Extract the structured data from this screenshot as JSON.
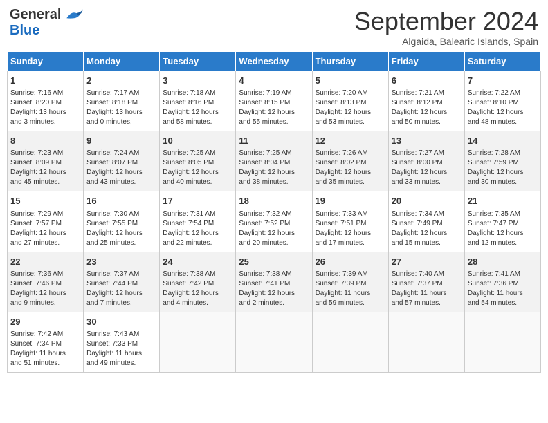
{
  "header": {
    "logo_general": "General",
    "logo_blue": "Blue",
    "month_title": "September 2024",
    "location": "Algaida, Balearic Islands, Spain"
  },
  "weekdays": [
    "Sunday",
    "Monday",
    "Tuesday",
    "Wednesday",
    "Thursday",
    "Friday",
    "Saturday"
  ],
  "weeks": [
    [
      {
        "day": "1",
        "info": "Sunrise: 7:16 AM\nSunset: 8:20 PM\nDaylight: 13 hours\nand 3 minutes."
      },
      {
        "day": "2",
        "info": "Sunrise: 7:17 AM\nSunset: 8:18 PM\nDaylight: 13 hours\nand 0 minutes."
      },
      {
        "day": "3",
        "info": "Sunrise: 7:18 AM\nSunset: 8:16 PM\nDaylight: 12 hours\nand 58 minutes."
      },
      {
        "day": "4",
        "info": "Sunrise: 7:19 AM\nSunset: 8:15 PM\nDaylight: 12 hours\nand 55 minutes."
      },
      {
        "day": "5",
        "info": "Sunrise: 7:20 AM\nSunset: 8:13 PM\nDaylight: 12 hours\nand 53 minutes."
      },
      {
        "day": "6",
        "info": "Sunrise: 7:21 AM\nSunset: 8:12 PM\nDaylight: 12 hours\nand 50 minutes."
      },
      {
        "day": "7",
        "info": "Sunrise: 7:22 AM\nSunset: 8:10 PM\nDaylight: 12 hours\nand 48 minutes."
      }
    ],
    [
      {
        "day": "8",
        "info": "Sunrise: 7:23 AM\nSunset: 8:09 PM\nDaylight: 12 hours\nand 45 minutes."
      },
      {
        "day": "9",
        "info": "Sunrise: 7:24 AM\nSunset: 8:07 PM\nDaylight: 12 hours\nand 43 minutes."
      },
      {
        "day": "10",
        "info": "Sunrise: 7:25 AM\nSunset: 8:05 PM\nDaylight: 12 hours\nand 40 minutes."
      },
      {
        "day": "11",
        "info": "Sunrise: 7:25 AM\nSunset: 8:04 PM\nDaylight: 12 hours\nand 38 minutes."
      },
      {
        "day": "12",
        "info": "Sunrise: 7:26 AM\nSunset: 8:02 PM\nDaylight: 12 hours\nand 35 minutes."
      },
      {
        "day": "13",
        "info": "Sunrise: 7:27 AM\nSunset: 8:00 PM\nDaylight: 12 hours\nand 33 minutes."
      },
      {
        "day": "14",
        "info": "Sunrise: 7:28 AM\nSunset: 7:59 PM\nDaylight: 12 hours\nand 30 minutes."
      }
    ],
    [
      {
        "day": "15",
        "info": "Sunrise: 7:29 AM\nSunset: 7:57 PM\nDaylight: 12 hours\nand 27 minutes."
      },
      {
        "day": "16",
        "info": "Sunrise: 7:30 AM\nSunset: 7:55 PM\nDaylight: 12 hours\nand 25 minutes."
      },
      {
        "day": "17",
        "info": "Sunrise: 7:31 AM\nSunset: 7:54 PM\nDaylight: 12 hours\nand 22 minutes."
      },
      {
        "day": "18",
        "info": "Sunrise: 7:32 AM\nSunset: 7:52 PM\nDaylight: 12 hours\nand 20 minutes."
      },
      {
        "day": "19",
        "info": "Sunrise: 7:33 AM\nSunset: 7:51 PM\nDaylight: 12 hours\nand 17 minutes."
      },
      {
        "day": "20",
        "info": "Sunrise: 7:34 AM\nSunset: 7:49 PM\nDaylight: 12 hours\nand 15 minutes."
      },
      {
        "day": "21",
        "info": "Sunrise: 7:35 AM\nSunset: 7:47 PM\nDaylight: 12 hours\nand 12 minutes."
      }
    ],
    [
      {
        "day": "22",
        "info": "Sunrise: 7:36 AM\nSunset: 7:46 PM\nDaylight: 12 hours\nand 9 minutes."
      },
      {
        "day": "23",
        "info": "Sunrise: 7:37 AM\nSunset: 7:44 PM\nDaylight: 12 hours\nand 7 minutes."
      },
      {
        "day": "24",
        "info": "Sunrise: 7:38 AM\nSunset: 7:42 PM\nDaylight: 12 hours\nand 4 minutes."
      },
      {
        "day": "25",
        "info": "Sunrise: 7:38 AM\nSunset: 7:41 PM\nDaylight: 12 hours\nand 2 minutes."
      },
      {
        "day": "26",
        "info": "Sunrise: 7:39 AM\nSunset: 7:39 PM\nDaylight: 11 hours\nand 59 minutes."
      },
      {
        "day": "27",
        "info": "Sunrise: 7:40 AM\nSunset: 7:37 PM\nDaylight: 11 hours\nand 57 minutes."
      },
      {
        "day": "28",
        "info": "Sunrise: 7:41 AM\nSunset: 7:36 PM\nDaylight: 11 hours\nand 54 minutes."
      }
    ],
    [
      {
        "day": "29",
        "info": "Sunrise: 7:42 AM\nSunset: 7:34 PM\nDaylight: 11 hours\nand 51 minutes."
      },
      {
        "day": "30",
        "info": "Sunrise: 7:43 AM\nSunset: 7:33 PM\nDaylight: 11 hours\nand 49 minutes."
      },
      {
        "day": "",
        "info": ""
      },
      {
        "day": "",
        "info": ""
      },
      {
        "day": "",
        "info": ""
      },
      {
        "day": "",
        "info": ""
      },
      {
        "day": "",
        "info": ""
      }
    ]
  ]
}
